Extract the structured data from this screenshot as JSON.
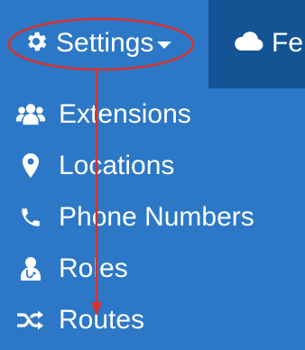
{
  "nav": {
    "settings": {
      "label": "Settings",
      "icon": "gear-icon"
    },
    "other": {
      "label": "Fe",
      "icon": "cloud-icon",
      "background": "#145495"
    }
  },
  "menu": {
    "items": [
      {
        "label": "Extensions",
        "icon": "users-icon"
      },
      {
        "label": "Locations",
        "icon": "map-marker-icon"
      },
      {
        "label": "Phone Numbers",
        "icon": "phone-icon"
      },
      {
        "label": "Roles",
        "icon": "user-doctor-icon"
      },
      {
        "label": "Routes",
        "icon": "shuffle-icon"
      }
    ]
  },
  "colors": {
    "background": "#2c78c6",
    "text": "#ffffff",
    "annotation": "#d9312b"
  }
}
